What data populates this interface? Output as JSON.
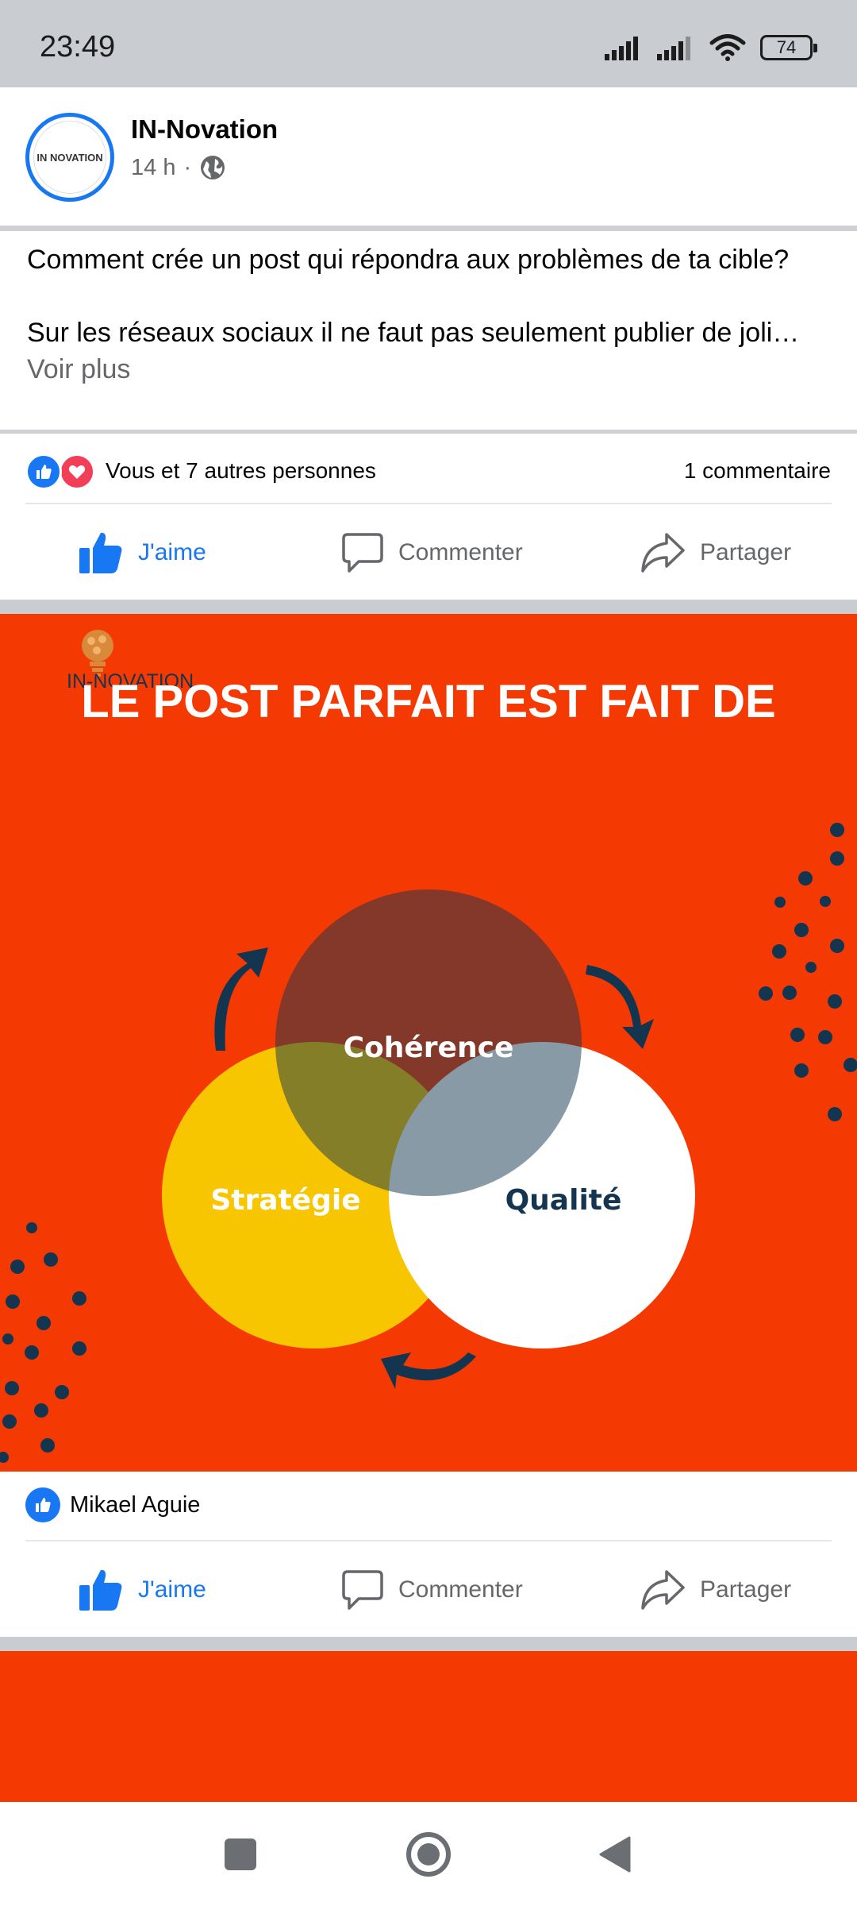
{
  "status_bar": {
    "time": "23:49",
    "battery": "74",
    "icons": [
      "signal-icon",
      "signal-icon",
      "wifi-icon",
      "battery-icon"
    ]
  },
  "post": {
    "page_name": "IN-Novation",
    "avatar_text": "IN NOVATION",
    "time": "14 h",
    "meta_separator": "·",
    "privacy_icon": "globe-icon",
    "text_line1": "Comment crée un post qui répondra aux problèmes de ta cible?",
    "text_line2": "Sur les réseaux sociaux il ne faut pas seulement publier de joli…",
    "see_more": "Voir plus",
    "reactions_text": "Vous et 7 autres personnes",
    "comments_count": "1 commentaire"
  },
  "actions": {
    "like": "J'aime",
    "comment": "Commenter",
    "share": "Partager"
  },
  "graphic": {
    "brand": "IN-NOVATION",
    "title": "LE POST PARFAIT EST FAIT DE",
    "circle_top": "Cohérence",
    "circle_left": "Stratégie",
    "circle_right": "Qualité",
    "colors": {
      "background": "#f43a02",
      "navy": "#14354f",
      "yellow": "#f7c600",
      "white": "#ffffff"
    }
  },
  "liker": {
    "name": "Mikael Aguie"
  },
  "colors": {
    "facebook_blue": "#1877f2",
    "love_red": "#f33e58",
    "secondary_text": "#65676b"
  },
  "navbar": {
    "icons": [
      "square-icon",
      "home-circle-icon",
      "back-triangle-icon"
    ]
  }
}
